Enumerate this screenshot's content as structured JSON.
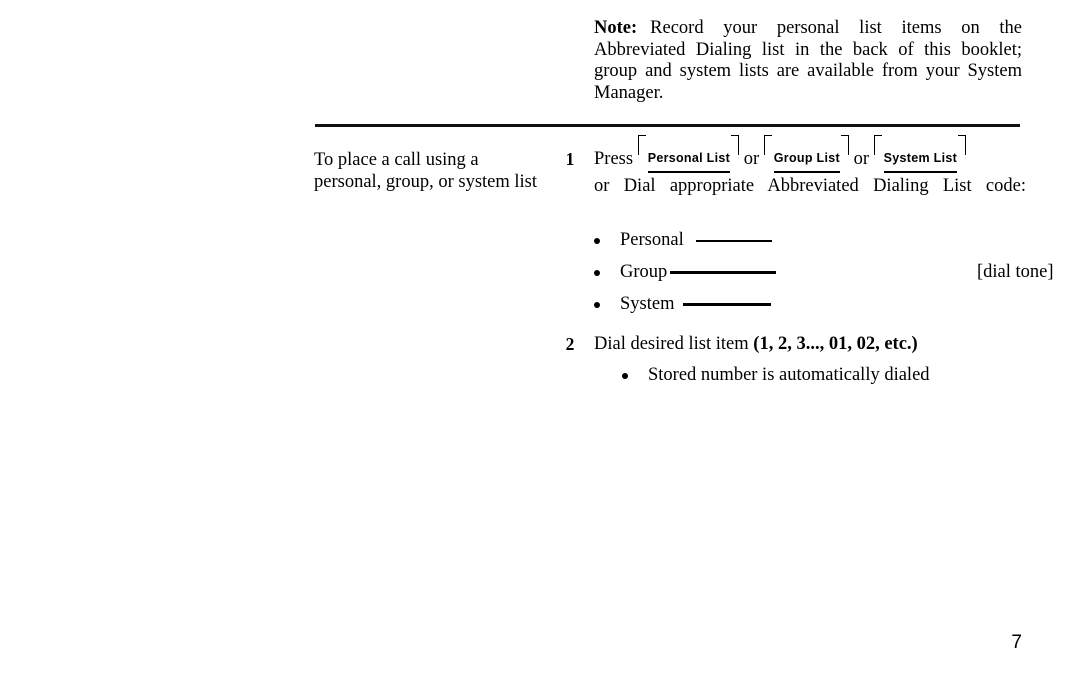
{
  "page": {
    "number": "7"
  },
  "note": {
    "label": "Note:",
    "text": "Record your personal list items on the Abbreviated Dialing list in the back of this booklet; group and system lists are available from your System Manager."
  },
  "section": {
    "heading": "To place a call using a personal, group, or system list"
  },
  "steps": [
    {
      "number": "1",
      "line1_prefix": "Press",
      "keys": [
        {
          "label": "Personal List"
        },
        {
          "label": "Group List"
        },
        {
          "label": "System List"
        }
      ],
      "key_separator": "or",
      "line2": "or Dial appropriate Abbreviated Dialing List code:",
      "bullets": [
        {
          "label": "Personal",
          "note": ""
        },
        {
          "label": "Group",
          "note": "[dial tone]"
        },
        {
          "label": "System",
          "note": ""
        }
      ]
    },
    {
      "number": "2",
      "text_plain": "Dial desired list item",
      "text_bold": "(1, 2, 3..., 01, 02, etc.)",
      "bullets": [
        {
          "label": "Stored number is automatically dialed"
        }
      ]
    }
  ]
}
